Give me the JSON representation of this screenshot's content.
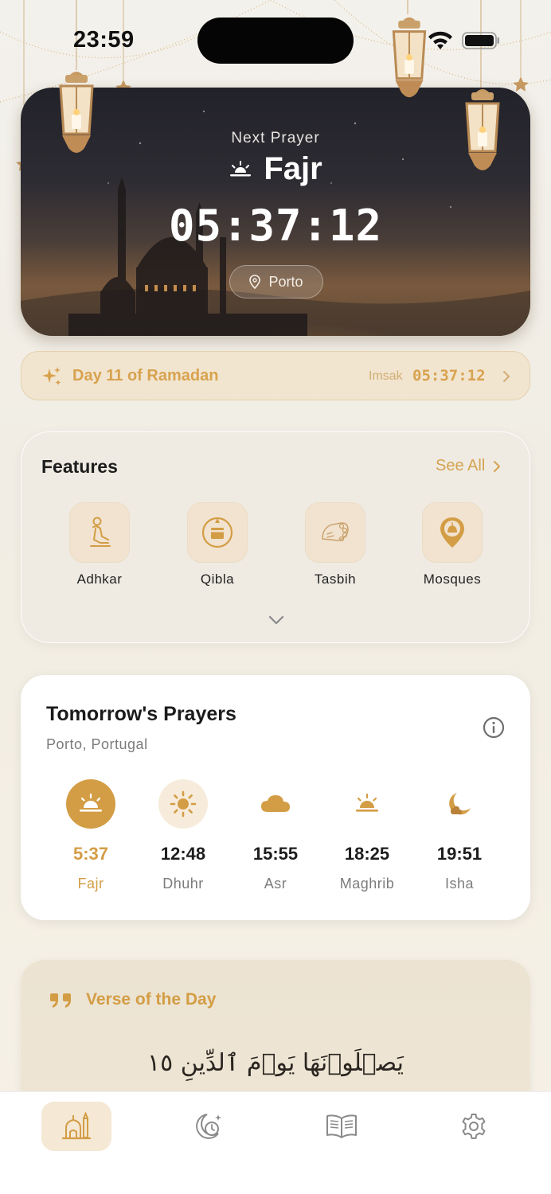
{
  "status_bar": {
    "time": "23:59"
  },
  "hero": {
    "next_label": "Next Prayer",
    "prayer_name": "Fajr",
    "countdown": "05:37:12",
    "location": "Porto"
  },
  "ramadan": {
    "day_text": "Day 11 of Ramadan",
    "imsak_label": "Imsak",
    "imsak_time": "05:37:12"
  },
  "features": {
    "title": "Features",
    "see_all": "See All",
    "items": [
      {
        "label": "Adhkar",
        "icon": "praying-person-icon"
      },
      {
        "label": "Qibla",
        "icon": "compass-kaaba-icon"
      },
      {
        "label": "Tasbih",
        "icon": "prayer-beads-icon"
      },
      {
        "label": "Mosques",
        "icon": "mosque-pin-icon"
      }
    ]
  },
  "tomorrow": {
    "title": "Tomorrow's Prayers",
    "location": "Porto, Portugal",
    "prayers": [
      {
        "time": "5:37",
        "name": "Fajr",
        "icon": "sunrise-icon",
        "active": true
      },
      {
        "time": "12:48",
        "name": "Dhuhr",
        "icon": "sun-icon"
      },
      {
        "time": "15:55",
        "name": "Asr",
        "icon": "cloud-icon"
      },
      {
        "time": "18:25",
        "name": "Maghrib",
        "icon": "sunset-icon"
      },
      {
        "time": "19:51",
        "name": "Isha",
        "icon": "moon-icon"
      }
    ]
  },
  "verse": {
    "title": "Verse of the Day",
    "arabic": "يَصۡلَوۡنَهَا يَوۡمَ ٱلدِّينِ ١٥"
  },
  "tab_bar": {
    "tabs": [
      {
        "icon": "mosque-home-icon",
        "active": true
      },
      {
        "icon": "moon-clock-icon"
      },
      {
        "icon": "quran-book-icon"
      },
      {
        "icon": "gear-icon"
      }
    ]
  },
  "colors": {
    "accent": "#D39D45",
    "accent_soft": "#F5E8D4",
    "text": "#1D1D1D",
    "muted": "#7C7C7C"
  }
}
